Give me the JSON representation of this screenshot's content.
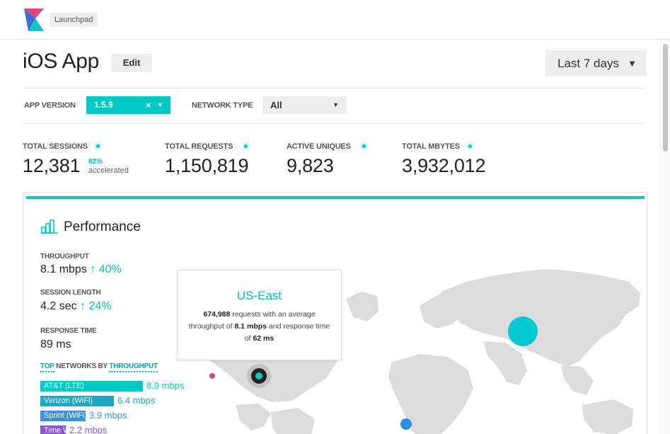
{
  "header": {
    "app_name": "Launchpad"
  },
  "page": {
    "title": "iOS App",
    "edit_label": "Edit",
    "date_range": "Last 7 days"
  },
  "filters": {
    "app_version_label": "APP VERSION",
    "app_version_value": "1.5.9",
    "network_type_label": "NETWORK TYPE",
    "network_type_value": "All"
  },
  "stats": [
    {
      "label": "TOTAL SESSIONS",
      "value": "12,381",
      "accel_pct": "82%",
      "accel_text": "accelerated"
    },
    {
      "label": "TOTAL REQUESTS",
      "value": "1,150,819"
    },
    {
      "label": "ACTIVE UNIQUES",
      "value": "9,823"
    },
    {
      "label": "TOTAL MBYTES",
      "value": "3,932,012"
    }
  ],
  "performance": {
    "title": "Performance",
    "metrics": [
      {
        "label": "THROUGHPUT",
        "value": "8.1 mbps",
        "delta": "↑ 40%"
      },
      {
        "label": "SESSION LENGTH",
        "value": "4.2 sec",
        "delta": "↑ 24%"
      },
      {
        "label": "RESPONSE TIME",
        "value": "89 ms",
        "delta": ""
      }
    ],
    "top_networks": {
      "prefix": "TOP",
      "middle": " NETWORKS BY ",
      "metric": "THROUGHPUT",
      "items": [
        {
          "name": "AT&T (LTE)",
          "value": "8.9 mbps",
          "mbps": 8.9,
          "color": "#00c9c8"
        },
        {
          "name": "Verizon (WiFi)",
          "value": "6.4 mbps",
          "mbps": 6.4,
          "color": "#1aaac7"
        },
        {
          "name": "Sprint (WiFi)",
          "value": "3.9 mbps",
          "mbps": 3.9,
          "color": "#3a91db"
        },
        {
          "name": "Time Warner",
          "value": "2.2 mbps",
          "mbps": 2.2,
          "color": "#8a55d6"
        }
      ]
    }
  },
  "tooltip": {
    "title": "US-East",
    "requests": "674,988",
    "text_1": " requests with an average throughput of ",
    "throughput": "8.1 mbps",
    "text_2": " and response time of ",
    "response_time": "62 ms"
  },
  "colors": {
    "accent": "#00c9c8",
    "land": "#dcdcdc"
  }
}
